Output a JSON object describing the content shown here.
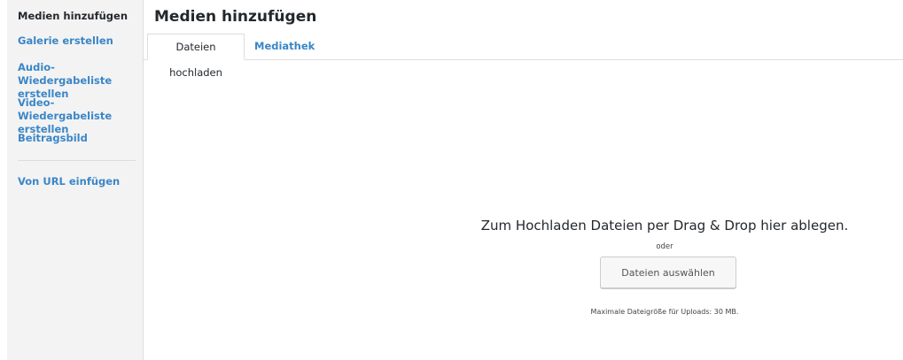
{
  "sidebar": {
    "items": [
      {
        "label": "Medien hinzufügen"
      },
      {
        "label": "Galerie erstellen"
      },
      {
        "label": "Audio-Wiedergabeliste erstellen"
      },
      {
        "label": "Video-Wiedergabeliste erstellen"
      },
      {
        "label": "Beitragsbild"
      },
      {
        "label": "Von URL einfügen"
      }
    ]
  },
  "header": {
    "title": "Medien hinzufügen"
  },
  "tabs": [
    {
      "label": "Dateien hochladen"
    },
    {
      "label": "Mediathek"
    }
  ],
  "upload": {
    "drop_instructions": "Zum Hochladen Dateien per Drag & Drop hier ablegen.",
    "or_label": "oder",
    "select_button_label": "Dateien auswählen",
    "max_size_text": "Maximale Dateigröße für Uploads: 30 MB."
  },
  "colors": {
    "link": "#3a86c7",
    "text": "#23282d",
    "sidebar_bg": "#f3f3f3",
    "border": "#dddddd"
  }
}
